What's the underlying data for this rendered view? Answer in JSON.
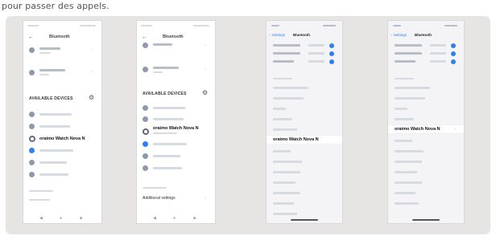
{
  "caption": "pour passer des appels.",
  "android": {
    "title": "Bluetooth",
    "available_devices": "AVAILABLE DEVICES",
    "device_name": "oraimo Watch Nova N",
    "additional_settings": "Additional settings"
  },
  "ios": {
    "back": "Settings",
    "title": "Bluetooth",
    "device_name": "oraimo Watch Nova N"
  },
  "colors": {
    "accent": "#2f80ed",
    "panel": "#e6e5e3"
  }
}
